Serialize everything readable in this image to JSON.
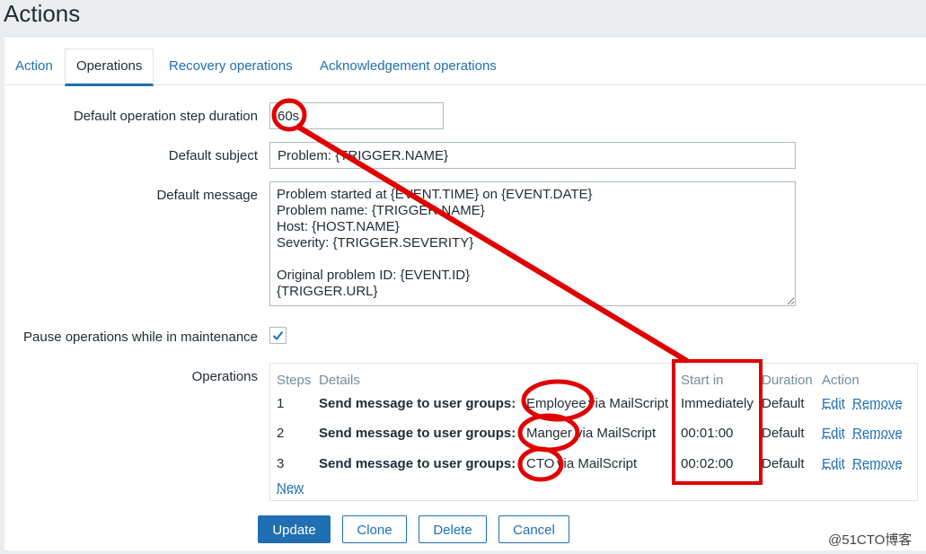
{
  "page": {
    "title": "Actions"
  },
  "tabs": [
    {
      "label": "Action"
    },
    {
      "label": "Operations"
    },
    {
      "label": "Recovery operations"
    },
    {
      "label": "Acknowledgement operations"
    }
  ],
  "form": {
    "step_duration": {
      "label": "Default operation step duration",
      "value": "60s"
    },
    "subject": {
      "label": "Default subject",
      "value": "Problem: {TRIGGER.NAME}"
    },
    "message": {
      "label": "Default message",
      "value": "Problem started at {EVENT.TIME} on {EVENT.DATE}\nProblem name: {TRIGGER.NAME}\nHost: {HOST.NAME}\nSeverity: {TRIGGER.SEVERITY}\n\nOriginal problem ID: {EVENT.ID}\n{TRIGGER.URL}"
    },
    "pause": {
      "label": "Pause operations while in maintenance",
      "checked": true
    }
  },
  "operations": {
    "label": "Operations",
    "headers": {
      "steps": "Steps",
      "details": "Details",
      "start_in": "Start in",
      "duration": "Duration",
      "action": "Action"
    },
    "rows": [
      {
        "step": "1",
        "prefix": "Send message to user groups:",
        "group": "Employee",
        "suffix": "via MailScript",
        "start_in": "Immediately",
        "duration": "Default",
        "edit": "Edit",
        "remove": "Remove"
      },
      {
        "step": "2",
        "prefix": "Send message to user groups:",
        "group": "Manger",
        "suffix": "via MailScript",
        "start_in": "00:01:00",
        "duration": "Default",
        "edit": "Edit",
        "remove": "Remove"
      },
      {
        "step": "3",
        "prefix": "Send message to user groups:",
        "group": "CTO",
        "suffix": "via MailScript",
        "start_in": "00:02:00",
        "duration": "Default",
        "edit": "Edit",
        "remove": "Remove"
      }
    ],
    "new_link": "New"
  },
  "buttons": {
    "update": "Update",
    "clone": "Clone",
    "delete": "Delete",
    "cancel": "Cancel"
  },
  "watermark": "@51CTO博客",
  "colors": {
    "accent": "#1f6fb2",
    "annotation": "#e00000"
  }
}
